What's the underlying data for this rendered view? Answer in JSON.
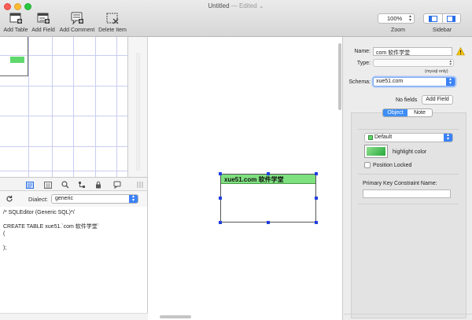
{
  "window": {
    "title": "Untitled",
    "subtitle": "— Edited ⌄"
  },
  "toolbar": {
    "add_table": "Add Table",
    "add_field": "Add Field",
    "add_comment": "Add Comment",
    "delete_item": "Delete Item",
    "zoom_value": "100%",
    "zoom_label": "Zoom",
    "sidebar_label": "Sidebar"
  },
  "sql_panel": {
    "dialect_label": "Dialect:",
    "dialect_value": "generic",
    "lines": [
      "/* SQLEditor (Generic SQL)*/",
      "",
      "CREATE TABLE xue51.`com 软件学堂`",
      "(",
      "",
      ");"
    ]
  },
  "canvas": {
    "table_name": "xue51.com 软件学堂"
  },
  "inspector": {
    "name_label": "Name:",
    "name_value": "com 软件学堂",
    "type_label": "Type:",
    "type_value": "",
    "mysql_only": "(mysql only)",
    "schema_label": "Schema:",
    "schema_value": "xue51.com",
    "no_fields": "No fields",
    "add_field_button": "Add Field",
    "tab_object": "Object",
    "tab_note": "Note",
    "color_value": "Default",
    "highlight_label": "highlight color",
    "position_locked": "Position Locked",
    "pk_label": "Primary Key Constraint Name:",
    "pk_value": ""
  },
  "colors": {
    "table_header": "#7ee07f",
    "accent": "#3b82f7",
    "selection_handle": "#1f3ee0"
  }
}
